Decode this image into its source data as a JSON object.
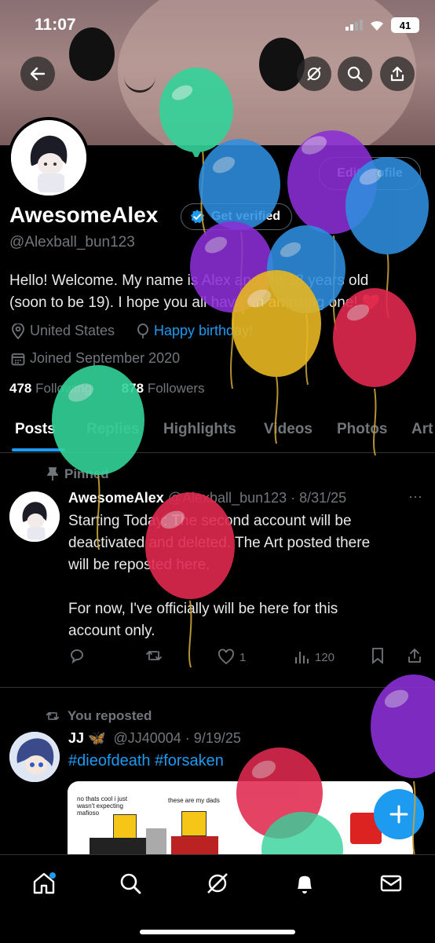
{
  "status_bar": {
    "time": "11:07",
    "battery": "41"
  },
  "profile": {
    "name": "AwesomeAlex",
    "verify_label": "Get verified",
    "handle": "@Alexball_bun123",
    "edit_label": "Edit profile",
    "bio_line1": "Hello! Welcome. My name is Alex and I'm 18 years old",
    "bio_line2": "(soon to be 19). I hope you all have an amazing one!",
    "bio_emoji": "❤️",
    "location": "United States",
    "birthday": "Happy birthday!",
    "joined": "Joined September 2020",
    "following_count": "478",
    "following_label": "Following",
    "followers_count": "878",
    "followers_label": "Followers"
  },
  "tabs": [
    "Posts",
    "Replies",
    "Highlights",
    "Videos",
    "Photos",
    "Art"
  ],
  "pinned_post": {
    "pinned_label": "Pinned",
    "author": "AwesomeAlex",
    "handle_date": "@Alexball_bun123 · 8/31/25",
    "line1": "Starting Today: The second account will be",
    "line2": "deactivated and deleted. The Art posted there",
    "line3": "will be reposted here.",
    "line4": "For now, I've officially will be here for this",
    "line5": "account only.",
    "likes": "1",
    "views": "120"
  },
  "repost": {
    "repost_label": "You reposted",
    "author": "JJ",
    "author_emoji": "🦋",
    "handle_date": "@JJ40004 · 9/19/25",
    "hashtags": "#dieofdeath #forsaken",
    "media_caption1": "no thats cool i just wasn't expecting mafioso",
    "media_caption2": "these are my dads"
  },
  "colors": {
    "accent": "#1d9bf0",
    "background": "#000000",
    "muted": "#71767b"
  },
  "icons": [
    "back-arrow-icon",
    "grok-icon",
    "search-icon",
    "share-icon",
    "verified-badge-icon",
    "location-icon",
    "balloon-icon",
    "calendar-icon",
    "pin-icon",
    "reply-icon",
    "repost-icon",
    "like-icon",
    "views-icon",
    "bookmark-icon",
    "home-icon",
    "bell-icon",
    "mail-icon",
    "plus-icon"
  ]
}
